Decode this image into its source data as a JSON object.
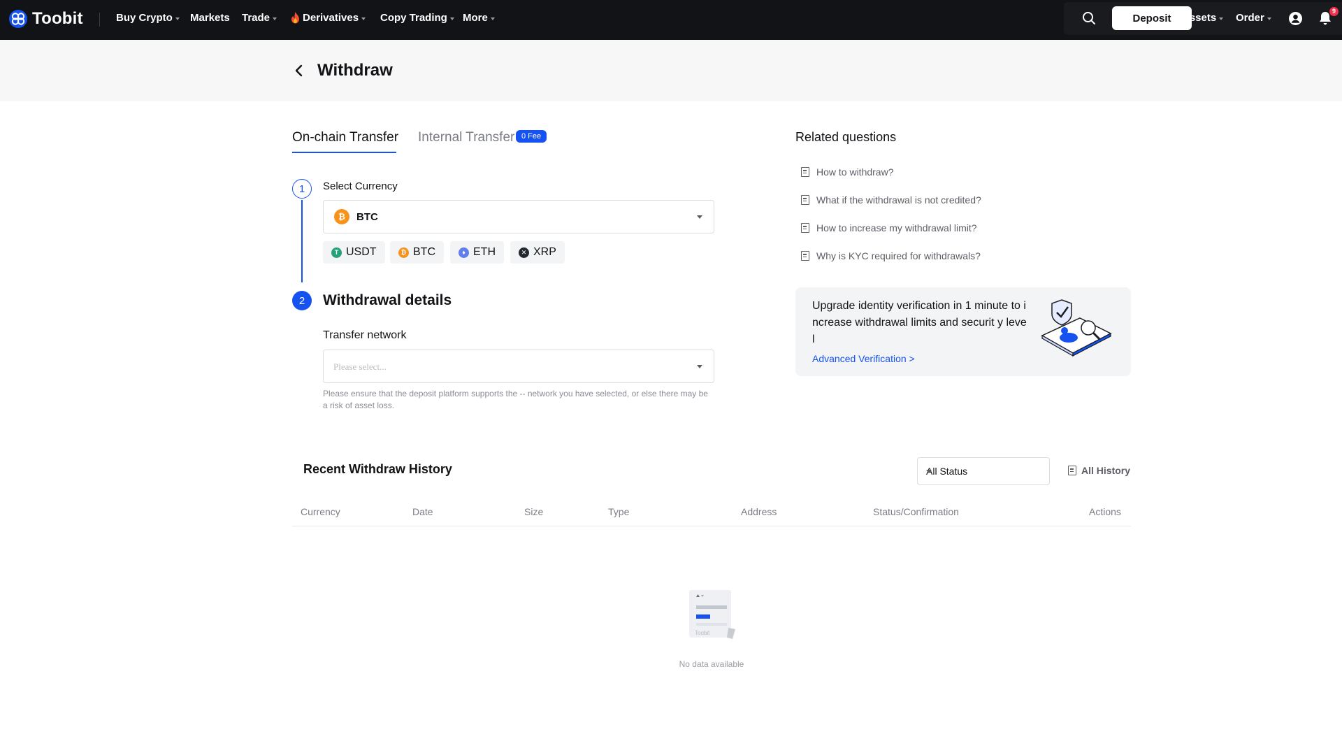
{
  "nav": {
    "brand": "Toobit",
    "items": [
      {
        "label": "Buy Crypto",
        "caret": true
      },
      {
        "label": "Markets",
        "caret": false
      },
      {
        "label": "Trade",
        "caret": true
      },
      {
        "label": "Derivatives",
        "caret": true,
        "icon": "fire-icon"
      },
      {
        "label": "Copy Trading",
        "caret": true
      },
      {
        "label": "More",
        "caret": true
      }
    ],
    "deposit_label": "Deposit",
    "assets_label": "Assets",
    "order_label": "Order",
    "notification_count": "9"
  },
  "page": {
    "title": "Withdraw"
  },
  "tabs": {
    "onchain": "On-chain Transfer",
    "internal": "Internal Transfer",
    "internal_badge": "0 Fee"
  },
  "step1": {
    "number": "1",
    "label": "Select Currency",
    "selected": "BTC",
    "chips": [
      {
        "label": "USDT",
        "color": "#26a17b"
      },
      {
        "label": "BTC",
        "color": "#f7931a"
      },
      {
        "label": "ETH",
        "color": "#627eea"
      },
      {
        "label": "XRP",
        "color": "#23292f"
      }
    ]
  },
  "step2": {
    "number": "2",
    "title": "Withdrawal details",
    "network_label": "Transfer network",
    "network_placeholder": "Please select...",
    "hint": "Please ensure that the deposit platform supports the -- network you have selected, or else there may be a risk of asset loss."
  },
  "related": {
    "title": "Related questions",
    "items": [
      "How to withdraw?",
      "What if the withdrawal is not credited?",
      "How to increase my withdrawal limit?",
      "Why is KYC required for withdrawals?"
    ]
  },
  "promo": {
    "text": "Upgrade identity verification in 1 minute to increase withdrawal limits and securit y level",
    "link": "Advanced Verification >"
  },
  "history": {
    "title": "Recent Withdraw History",
    "status_filter": "All Status",
    "all_history": "All History",
    "columns": [
      "Currency",
      "Date",
      "Size",
      "Type",
      "Address",
      "Status/Confirmation",
      "Actions"
    ],
    "empty_text": "No data available",
    "empty_art_label": "Toobit"
  },
  "colors": {
    "accent": "#1552f0",
    "nav_bg": "#121316",
    "btc": "#f7931a"
  }
}
